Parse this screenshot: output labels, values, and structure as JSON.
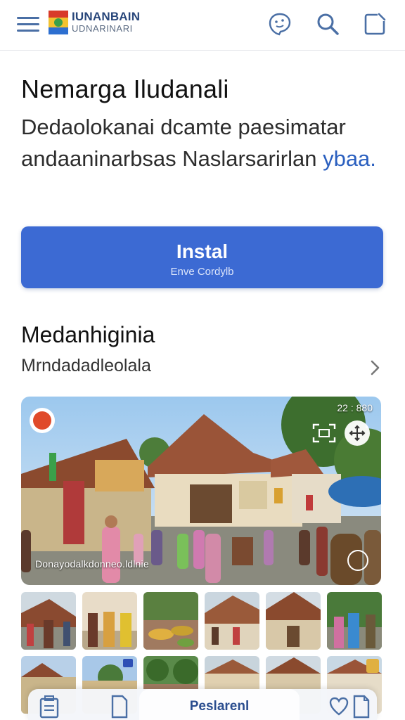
{
  "header": {
    "brand_line1": "IUNANBAIN",
    "brand_line2": "UDNARINARI",
    "icons": [
      "menu-icon",
      "emblem-logo",
      "face-icon",
      "search-icon",
      "edit-icon"
    ]
  },
  "hero": {
    "title": "Nemarga Iludanali",
    "description": "Dedaolokanai dcamte paesimatar andaaninarbsas Naslarsarirlan",
    "description_link": "ybaa."
  },
  "install_button": {
    "label": "Instal",
    "sublabel": "Enve Cordylb"
  },
  "section": {
    "title": "Medanhiginia",
    "subtitle": "Mrndadadleolala"
  },
  "feature": {
    "caption": "Donayodalkdonneo.ldlnie",
    "time": "22 : 880"
  },
  "bottom_nav": {
    "active_label": "Peslarenl"
  },
  "colors": {
    "accent": "#3c6ad3",
    "brand_text": "#28467a",
    "link": "#2a5fbf",
    "icon": "#4a6fa5"
  }
}
